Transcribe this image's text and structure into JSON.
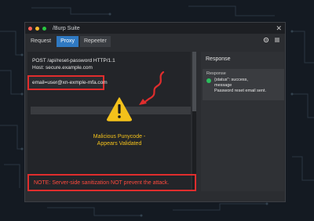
{
  "window": {
    "title": "/Burp Suite"
  },
  "tabs": [
    {
      "label": "Request"
    },
    {
      "label": "Proxy"
    },
    {
      "label": "Repeeter"
    }
  ],
  "request": {
    "line1": "POST /api/reset-password HTTP/1.1",
    "line2": "Host: secure.example.com",
    "email_value": "email=user@xn-exmple-mfa.com"
  },
  "warning": {
    "line1": "Malicious Punycode -",
    "line2": "Appears Validated",
    "icon": "warning-triangle-icon"
  },
  "response": {
    "heading": "Response",
    "panel_label": "Response",
    "line1": "{status\": success,",
    "line2": "message",
    "line3": "Password reset email sent."
  },
  "note": "NOTE: Server-side sanitization NOT prevent the attack.",
  "colors": {
    "accent_red": "#e02d2d",
    "warning_yellow": "#f3c11b",
    "tab_active": "#2f79c2",
    "success_green": "#2bbf5d"
  }
}
